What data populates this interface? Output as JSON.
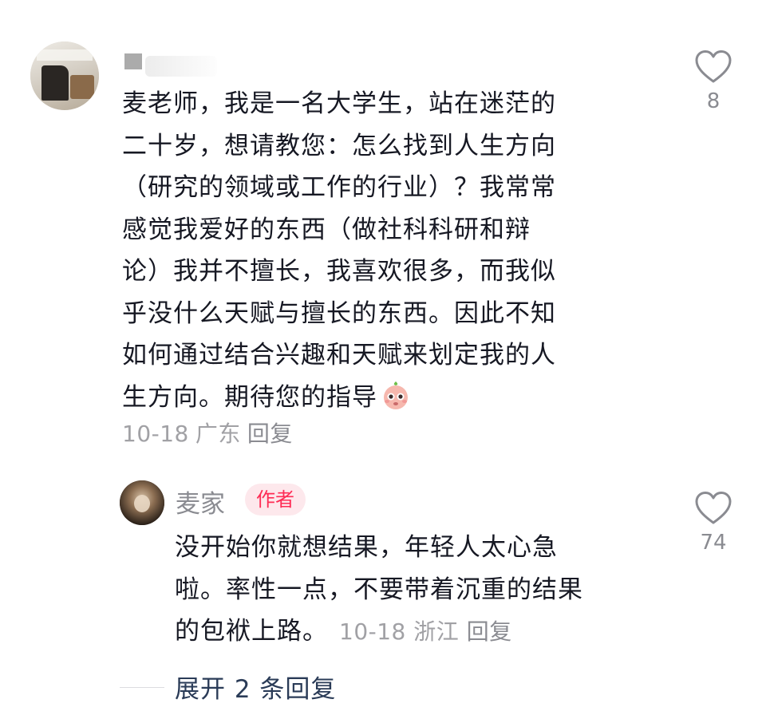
{
  "comment": {
    "lines": [
      "麦老师，我是一名大学生，站在迷茫的",
      "二十岁，想请教您：怎么找到人生方向",
      "（研究的领域或工作的行业）？我常常",
      "感觉我爱好的东西（做社科科研和辩",
      "论）我并不擅长，我喜欢很多，而我似",
      "乎没什么天赋与擅长的东西。因此不知",
      "如何通过结合兴趣和天赋来划定我的人",
      "生方向。期待您的指导"
    ],
    "emoji": "pleading-face-emoji",
    "date": "10-18",
    "location": "广东",
    "reply_label": "回复",
    "like_count": "8"
  },
  "reply": {
    "username": "麦家",
    "badge": "作者",
    "lines": [
      "没开始你就想结果，年轻人太心急",
      "啦。率性一点，不要带着沉重的结果",
      "的包袱上路。"
    ],
    "date": "10-18",
    "location": "浙江",
    "reply_label": "回复",
    "like_count": "74"
  },
  "expand_label": "展开 2 条回复",
  "colors": {
    "accent": "#fe2c55",
    "text": "#161823",
    "muted": "#a1a1a5",
    "link": "#2a3b57"
  }
}
